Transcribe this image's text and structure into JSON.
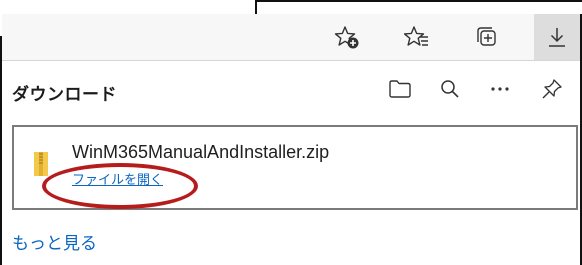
{
  "toolbar": {
    "icons": [
      "add-favorite-icon",
      "favorites-icon",
      "collections-icon",
      "downloads-icon"
    ],
    "active": "downloads-icon"
  },
  "downloads_panel": {
    "title": "ダウンロード",
    "header_icons": [
      "open-folder-icon",
      "search-icon",
      "more-options-icon",
      "pin-icon"
    ],
    "items": [
      {
        "file_name": "WinM365ManualAndInstaller.zip",
        "action_label": "ファイルを開く",
        "icon": "zip-file-icon"
      }
    ],
    "see_more_label": "もっと見る"
  },
  "colors": {
    "link": "#0a66c2",
    "highlight": "#b71c1c",
    "toolbar_active": "#dddddd"
  }
}
